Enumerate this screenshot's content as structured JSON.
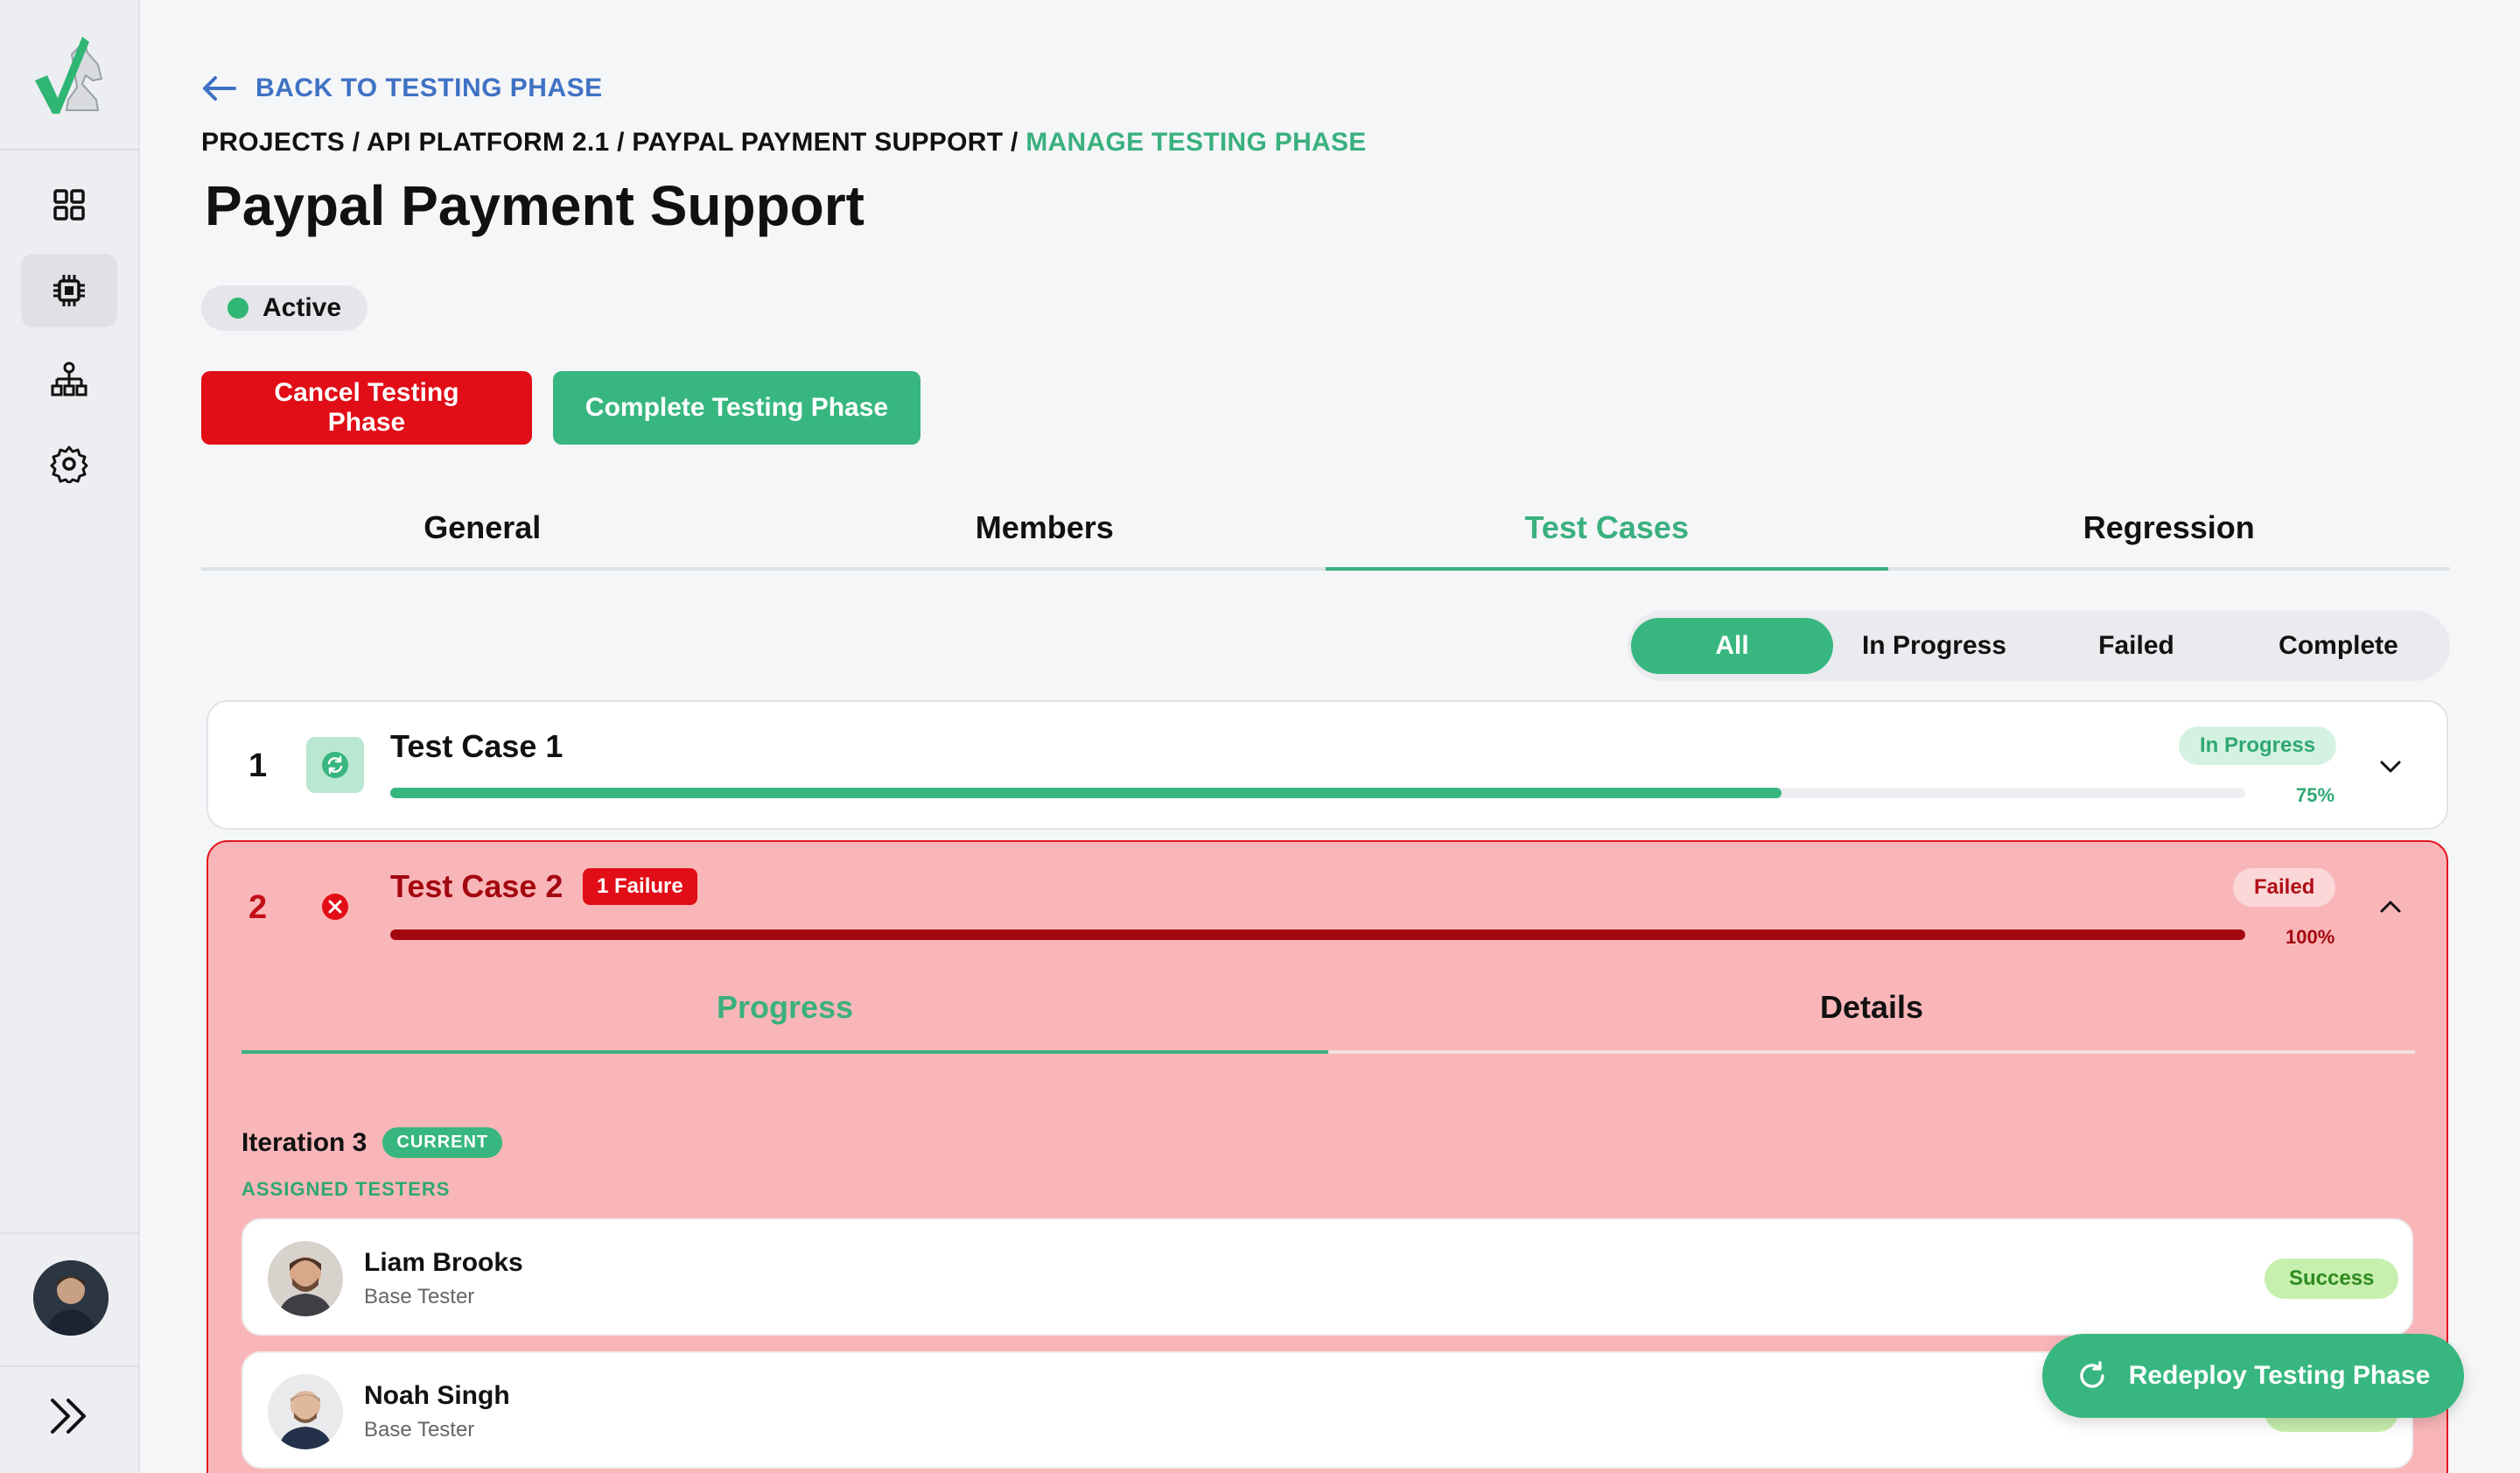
{
  "back_link": "BACK TO TESTING PHASE",
  "breadcrumb": {
    "projects": "PROJECTS",
    "project": "API PLATFORM 2.1",
    "feature": "PAYPAL PAYMENT SUPPORT",
    "current": "MANAGE TESTING PHASE",
    "sep": " / "
  },
  "title": "Paypal Payment Support",
  "status": "Active",
  "buttons": {
    "cancel": "Cancel Testing Phase",
    "complete": "Complete Testing Phase",
    "redeploy": "Redeploy Testing Phase"
  },
  "tabs": [
    "General",
    "Members",
    "Test Cases",
    "Regression"
  ],
  "filters": [
    "All",
    "In Progress",
    "Failed",
    "Complete"
  ],
  "test_cases": [
    {
      "num": "1",
      "title": "Test Case 1",
      "status": "In Progress",
      "progress_pct": "75%",
      "progress": 0.75
    },
    {
      "num": "2",
      "title": "Test Case 2",
      "failure_tag": "1 Failure",
      "status": "Failed",
      "progress_pct": "100%",
      "progress": 1.0,
      "subtabs": [
        "Progress",
        "Details"
      ],
      "iteration": "Iteration 3",
      "iteration_tag": "CURRENT",
      "assigned_label": "ASSIGNED TESTERS",
      "testers": [
        {
          "name": "Liam Brooks",
          "role": "Base Tester",
          "result": "Success"
        },
        {
          "name": "Noah Singh",
          "role": "Base Tester",
          "result": "Success"
        }
      ]
    }
  ],
  "colors": {
    "accent": "#37b77f",
    "danger": "#e10d17",
    "link": "#3f72c4",
    "failed_bg": "#f9b6b8"
  }
}
